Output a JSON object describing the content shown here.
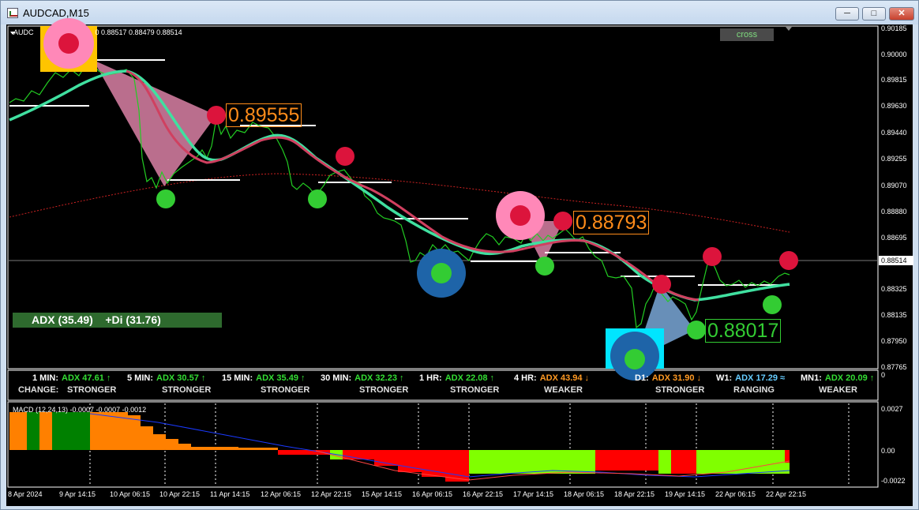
{
  "window": {
    "title": "AUDCAD,M15",
    "buttons": [
      "minimize",
      "maximize",
      "close"
    ]
  },
  "chart": {
    "symbol_info": "AUDCAD,M15 0.88517 0.88479 0.88514",
    "symbol_short": "AUDC",
    "symbol_tail": "0 0.88517 0.88479 0.88514",
    "current_price": "0.88514",
    "price_axis": [
      "0.90185",
      "0.90000",
      "0.89815",
      "0.89630",
      "0.89440",
      "0.89255",
      "0.89070",
      "0.88880",
      "0.88695",
      "0.88325",
      "0.88135",
      "0.87950",
      "0.87765"
    ],
    "time_axis": [
      "8 Apr 2024",
      "9 Apr 14:15",
      "10 Apr 06:15",
      "10 Apr 22:15",
      "11 Apr 14:15",
      "12 Apr 06:15",
      "12 Apr 22:15",
      "15 Apr 14:15",
      "16 Apr 06:15",
      "16 Apr 22:15",
      "17 Apr 14:15",
      "18 Apr 06:15",
      "18 Apr 22:15",
      "19 Apr 14:15",
      "22 Apr 06:15",
      "22 Apr 22:15"
    ],
    "annotations": [
      {
        "text": "0.89555",
        "color": "#ff8c1a"
      },
      {
        "text": "0.88793",
        "color": "#ff8c1a"
      },
      {
        "text": "0.88017",
        "color": "#33cc33"
      }
    ],
    "cross_label": "cross",
    "adx_box": "ADX (35.49)    +Di (31.76)"
  },
  "mtf": {
    "change_label": "CHANGE:",
    "items": [
      {
        "tf": "1 MIN:",
        "adx": "ADX 47.61",
        "arrow": "↑",
        "state": "STRONGER",
        "color": "#33dd33"
      },
      {
        "tf": "5 MIN:",
        "adx": "ADX 30.57",
        "arrow": "↑",
        "state": "STRONGER",
        "color": "#33dd33"
      },
      {
        "tf": "15 MIN:",
        "adx": "ADX 35.49",
        "arrow": "↑",
        "state": "STRONGER",
        "color": "#33dd33"
      },
      {
        "tf": "30 MIN:",
        "adx": "ADX 32.23",
        "arrow": "↑",
        "state": "STRONGER",
        "color": "#33dd33"
      },
      {
        "tf": "1 HR:",
        "adx": "ADX 22.08",
        "arrow": "↑",
        "state": "STRONGER",
        "color": "#33dd33"
      },
      {
        "tf": "4 HR:",
        "adx": "ADX 43.94",
        "arrow": "↓",
        "state": "WEAKER",
        "color": "#ff9922"
      },
      {
        "tf": "D1:",
        "adx": "ADX 31.90",
        "arrow": "↓",
        "state": "STRONGER",
        "color": "#ff9922"
      },
      {
        "tf": "W1:",
        "adx": "ADX 17.29",
        "arrow": "≈",
        "state": "RANGING",
        "color": "#66ccff"
      },
      {
        "tf": "MN1:",
        "adx": "ADX 20.09",
        "arrow": "↑",
        "state": "WEAKER",
        "color": "#33dd33"
      }
    ],
    "sub_axis": [
      "0"
    ]
  },
  "macd": {
    "label": "MACD (12,24,13) -0.0007 -0.0007 -0.0012",
    "axis": [
      "0.0027",
      "0.00",
      "-0.0022"
    ]
  },
  "colors": {
    "background": "#000000",
    "price_line": "#2ecc2e",
    "fast_ma": "#40e0a0",
    "slow_ma": "#d04060",
    "long_ma": "#cc2222",
    "macd_up": "#80ff00",
    "macd_down": "#ff0000",
    "macd_orange": "#ff8000",
    "macd_green": "#008000"
  }
}
